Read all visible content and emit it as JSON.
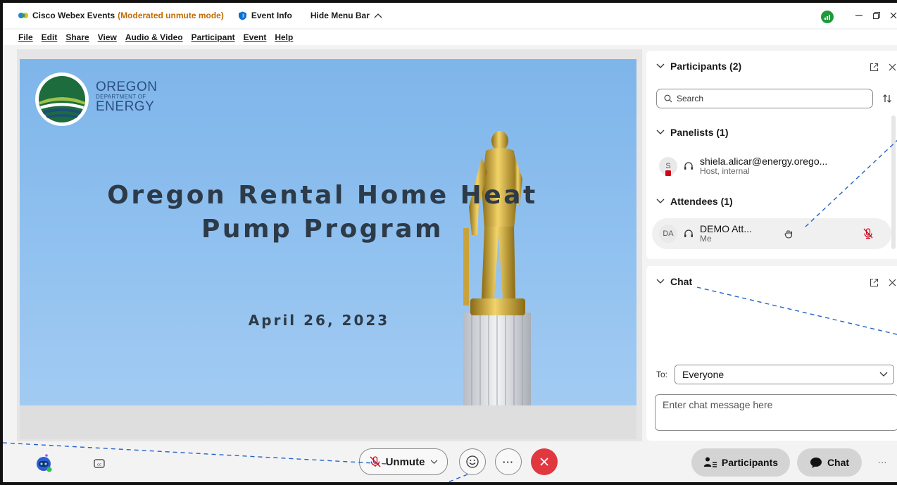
{
  "window": {
    "app_title": "Cisco Webex Events",
    "mode": "(Moderated unmute mode)",
    "event_info": "Event Info",
    "hide_menu": "Hide Menu Bar"
  },
  "menu": [
    "File",
    "Edit",
    "Share",
    "View",
    "Audio & Video",
    "Participant",
    "Event",
    "Help"
  ],
  "slide": {
    "logo_line1": "OREGON",
    "logo_line2": "DEPARTMENT OF",
    "logo_line3": "ENERGY",
    "title_line1": "Oregon Rental Home Heat",
    "title_line2": "Pump Program",
    "date": "April 26, 2023"
  },
  "participants": {
    "title": "Participants (2)",
    "search_placeholder": "Search",
    "panelists_heading": "Panelists (1)",
    "attendees_heading": "Attendees (1)",
    "panelists": [
      {
        "initial": "S",
        "name": "shiela.alicar@energy.orego...",
        "role": "Host, internal"
      }
    ],
    "attendees": [
      {
        "initial": "DA",
        "name": "DEMO Att...",
        "role": "Me"
      }
    ]
  },
  "chat": {
    "title": "Chat",
    "to_label": "To:",
    "to_value": "Everyone",
    "input_placeholder": "Enter chat message here"
  },
  "controls": {
    "unmute": "Unmute",
    "participants": "Participants",
    "chat": "Chat",
    "more": "···"
  },
  "colors": {
    "mode_text": "#c26b00",
    "leave_button": "#e0383e",
    "webex_blue": "#0a6ed1",
    "status_green": "#1f9a3a",
    "dashed_line": "#2563c9"
  }
}
